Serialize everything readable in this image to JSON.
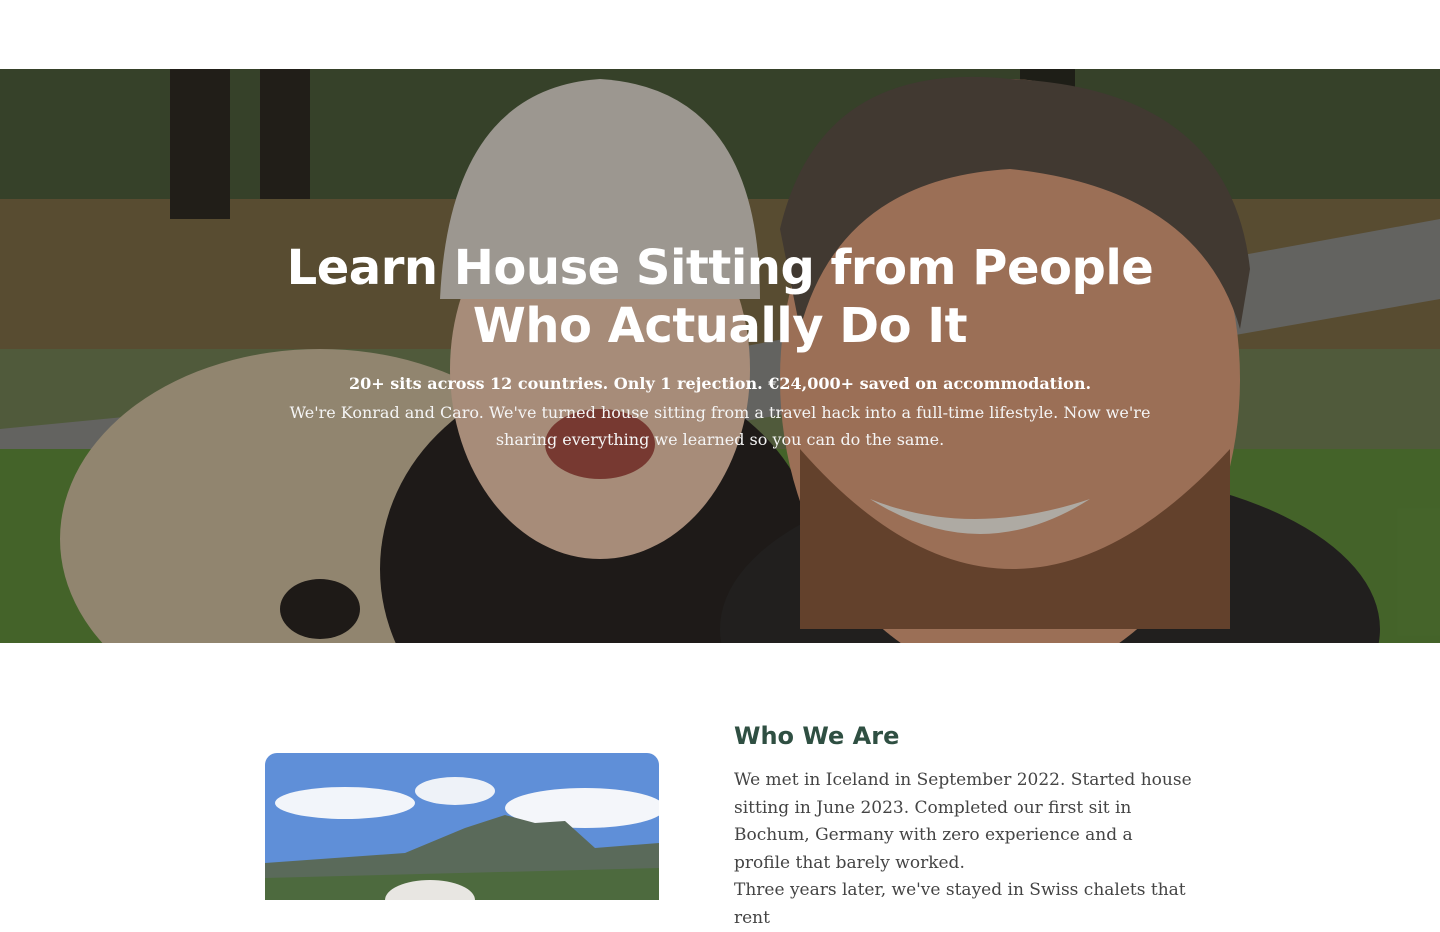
{
  "hero": {
    "title": "Learn House Sitting from People Who Actually Do It",
    "stats": "20+ sits across 12 countries. Only 1 rejection. €24,000+ saved on accommodation.",
    "intro": "We're Konrad and Caro. We've turned house sitting from a travel hack into a full-time lifestyle. Now we're sharing everything we learned so you can do the same."
  },
  "about": {
    "title": "Who We Are",
    "paragraph1": "We met in Iceland in September 2022. Started house sitting in June 2023. Completed our first sit in Bochum, Germany with zero experience and a profile that barely worked.",
    "paragraph2": "Three years later, we've stayed in Swiss chalets that rent"
  },
  "colors": {
    "heading": "#2f4f42",
    "body_text": "#444444",
    "hero_text": "#ffffff"
  }
}
